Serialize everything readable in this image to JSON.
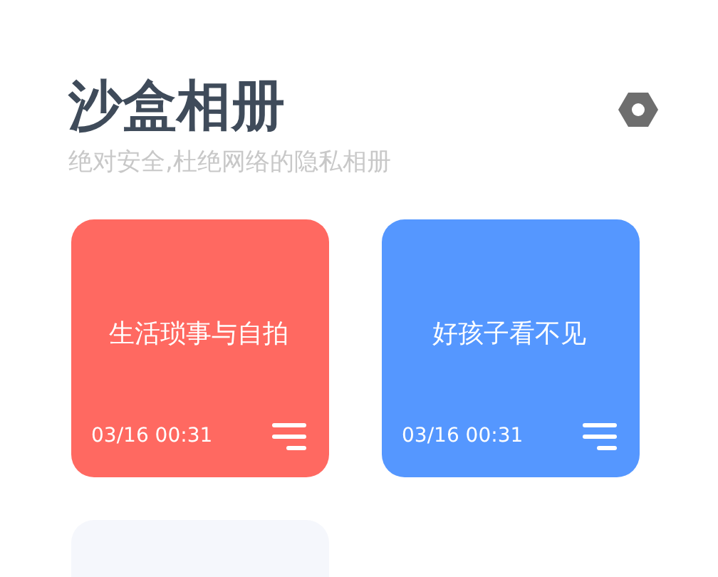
{
  "header": {
    "title": "沙盒相册",
    "subtitle": "绝对安全,杜绝网络的隐私相册"
  },
  "albums": [
    {
      "name": "生活琐事与自拍",
      "time": "03/16 00:31",
      "color": "#ff6961"
    },
    {
      "name": "好孩子看不见",
      "time": "03/16 00:31",
      "color": "#5597ff"
    },
    {
      "color": "#f5f7fc"
    }
  ]
}
